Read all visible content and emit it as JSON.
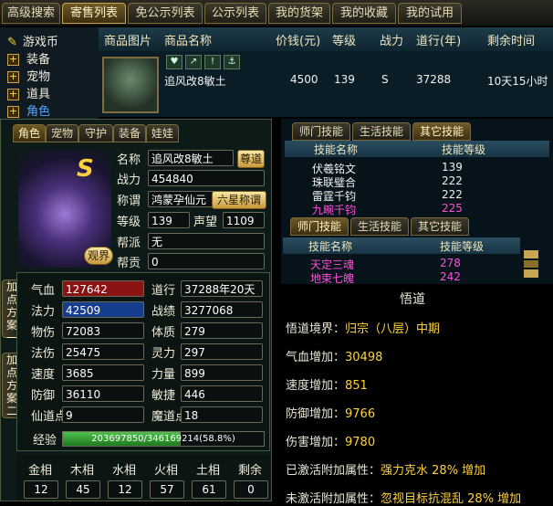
{
  "top_tabs": [
    "高级搜索",
    "寄售列表",
    "免公示列表",
    "公示列表",
    "我的货架",
    "我的收藏",
    "我的试用"
  ],
  "tree": [
    "游戏币",
    "装备",
    "宠物",
    "道具",
    "角色"
  ],
  "list_header": [
    "商品图片",
    "商品名称",
    "价钱(元)",
    "等级",
    "战力",
    "道行(年)",
    "剩余时间"
  ],
  "list_row": {
    "name": "追风改8敏土",
    "price": "4500",
    "level": "139",
    "power": "S",
    "daohang": "37288",
    "remaining": "10天15小时"
  },
  "row_icons": [
    "heart-icon",
    "share-icon",
    "alert-icon",
    "anchor-icon"
  ],
  "sub_tabs": [
    "角色",
    "宠物",
    "守护",
    "装备",
    "娃娃"
  ],
  "char": {
    "name_label": "名称",
    "name": "追风改8敏土",
    "zunjia_button": "尊道",
    "power_label": "战力",
    "power": "454840",
    "title_label": "称谓",
    "title": "鸿蒙孕仙元",
    "title_button": "六星称谓",
    "level_label": "等级",
    "level": "139",
    "fame_label": "声望",
    "fame": "1109",
    "faction_label": "帮派",
    "faction": "无",
    "contrib_label": "帮贡",
    "contrib": "0",
    "badge": "S",
    "view_button": "观界"
  },
  "stats": [
    {
      "l": "气血",
      "v": "127642",
      "l2": "道行",
      "v2": "37288年20天"
    },
    {
      "l": "法力",
      "v": "42509",
      "l2": "战绩",
      "v2": "3277068"
    },
    {
      "l": "物伤",
      "v": "72083",
      "l2": "体质",
      "v2": "279"
    },
    {
      "l": "法伤",
      "v": "25475",
      "l2": "灵力",
      "v2": "297"
    },
    {
      "l": "速度",
      "v": "3685",
      "l2": "力量",
      "v2": "899"
    },
    {
      "l": "防御",
      "v": "36110",
      "l2": "敏捷",
      "v2": "446"
    },
    {
      "l": "仙道点",
      "v": "9",
      "l2": "魔道点",
      "v2": "18"
    }
  ],
  "exp": {
    "label": "经验",
    "text": "203697850/346169214(58.8%)",
    "fraction": 0.588
  },
  "side_buttons": [
    "加点方案一",
    "加点方案二"
  ],
  "attrs": {
    "headers": [
      "金相",
      "木相",
      "水相",
      "火相",
      "土相",
      "剩余"
    ],
    "values": [
      "12",
      "45",
      "12",
      "57",
      "61",
      "0"
    ]
  },
  "skill_tabs_top": [
    "师门技能",
    "生活技能",
    "其它技能"
  ],
  "skill_header": [
    "技能名称",
    "技能等级"
  ],
  "skills_top": [
    {
      "name": "伏羲铭文",
      "level": "139"
    },
    {
      "name": "珠联璧合",
      "level": "222"
    },
    {
      "name": "雷霆千钧",
      "level": "222"
    },
    {
      "name": "九畹千钧",
      "level": "225"
    }
  ],
  "skill_tabs_bottom": [
    "师门技能",
    "生活技能",
    "其它技能"
  ],
  "skills_bottom": [
    {
      "name": "天定三魂",
      "level": "278"
    },
    {
      "name": "地束七魄",
      "level": "242"
    }
  ],
  "tooltip": {
    "title": "悟道",
    "rows": [
      {
        "k": "悟道境界：",
        "v": "归宗（八层）中期"
      },
      {
        "k": "气血增加：",
        "v": "30498"
      },
      {
        "k": "速度增加：",
        "v": "851"
      },
      {
        "k": "防御增加：",
        "v": "9766"
      },
      {
        "k": "伤害增加：",
        "v": "9780"
      },
      {
        "k": "已激活附加属性：",
        "v": "强力克水 28% 增加"
      },
      {
        "k": "未激活附加属性：",
        "v": "忽视目标抗混乱 28% 增加"
      }
    ]
  },
  "colors": {
    "hp_bar": "#8a1414",
    "mp_bar": "#153e8e",
    "exp_bar": "#1d7a1d",
    "gold": "#ffd23a",
    "purple": "#ff4fd8"
  }
}
